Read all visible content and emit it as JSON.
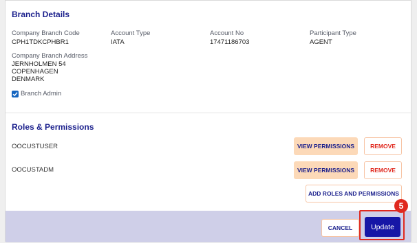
{
  "branch_details": {
    "title": "Branch Details",
    "fields": [
      {
        "label": "Company Branch Code",
        "value": "CPH1TDKCPHBR1"
      },
      {
        "label": "Account Type",
        "value": "IATA"
      },
      {
        "label": "Account No",
        "value": "17471186703"
      },
      {
        "label": "Participant Type",
        "value": "AGENT"
      }
    ],
    "address_label": "Company Branch Address",
    "address_lines": [
      "JERNHOLMEN 54",
      "COPENHAGEN",
      "DENMARK"
    ],
    "branch_admin_label": "Branch Admin",
    "branch_admin_checked": true
  },
  "roles": {
    "title": "Roles & Permissions",
    "items": [
      {
        "name": "OOCUSTUSER",
        "view_label": "VIEW PERMISSIONS",
        "remove_label": "REMOVE"
      },
      {
        "name": "OOCUSTADM",
        "view_label": "VIEW PERMISSIONS",
        "remove_label": "REMOVE"
      }
    ],
    "add_label": "ADD ROLES AND PERMISSIONS"
  },
  "footer": {
    "cancel_label": "CANCEL",
    "update_label": "Update"
  },
  "step_badge": "5",
  "colors": {
    "accent": "#1a1f8c",
    "highlight": "#e0281e",
    "primary_button": "#1616a6",
    "soft_button": "#fcd9b8",
    "footer_bg": "#cfcfe8"
  }
}
